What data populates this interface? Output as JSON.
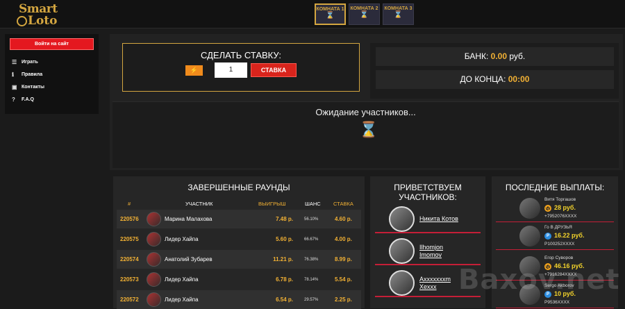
{
  "logo": {
    "line1": "Smart",
    "line2": "Loto"
  },
  "rooms": [
    {
      "label": "КОМНАТА 1",
      "icon": "⌛",
      "active": true
    },
    {
      "label": "КОМНАТА 2",
      "icon": "⌛",
      "active": false
    },
    {
      "label": "КОМНАТА 3",
      "icon": "⌛",
      "active": false
    }
  ],
  "sidebar": {
    "login_label": "Войти на сайт",
    "items": [
      {
        "icon": "☰",
        "label": "Играть"
      },
      {
        "icon": "ℹ",
        "label": "Правила"
      },
      {
        "icon": "▣",
        "label": "Контакты"
      },
      {
        "icon": "?",
        "label": "F.A.Q"
      }
    ]
  },
  "bet": {
    "title": "СДЕЛАТЬ СТАВКУ:",
    "bolt_icon": "⚡",
    "value": "1",
    "button_label": "СТАВКА"
  },
  "bank": {
    "bank_label": "БАНК:",
    "bank_value": "0.00",
    "bank_unit": "руб.",
    "timer_label": "ДО КОНЦА:",
    "timer_value": "00:00"
  },
  "waiting": {
    "text": "Ожидание участников...",
    "icon": "⌛"
  },
  "rounds": {
    "title": "ЗАВЕРШЕННЫЕ РАУНДЫ",
    "headers": {
      "num": "#",
      "participant": "УЧАСТНИК",
      "win": "ВЫИГРЫШ",
      "chance": "ШАНС",
      "stake": "СТАВКА"
    },
    "rows": [
      {
        "num": "220576",
        "name": "Марина Малахова",
        "win": "7.48 р.",
        "chance": "56.10%",
        "stake": "4.60 р."
      },
      {
        "num": "220575",
        "name": "Лидер Хайпа",
        "win": "5.60 р.",
        "chance": "66.67%",
        "stake": "4.00 р."
      },
      {
        "num": "220574",
        "name": "Анатолий Зубарев",
        "win": "11.21 р.",
        "chance": "76.38%",
        "stake": "8.99 р."
      },
      {
        "num": "220573",
        "name": "Лидер Хайпа",
        "win": "6.78 р.",
        "chance": "78.14%",
        "stake": "5.54 р."
      },
      {
        "num": "220572",
        "name": "Лидер Хайпа",
        "win": "6.54 р.",
        "chance": "29.57%",
        "stake": "2.25 р."
      }
    ]
  },
  "welcome": {
    "title_line1": "ПРИВЕТСТВУЕМ",
    "title_line2": "УЧАСТНИКОВ:",
    "users": [
      {
        "name_line1": "Никита Котов",
        "name_line2": ""
      },
      {
        "name_line1": "Ilhomjon",
        "name_line2": "Imomov"
      },
      {
        "name_line1": "Axxxxxxxm",
        "name_line2": "Xexxx"
      }
    ]
  },
  "payouts": {
    "title": "ПОСЛЕДНИЕ ВЫПЛАТЫ:",
    "items": [
      {
        "name": "Витя Торгашов",
        "system_icon": "Q",
        "system": "qiwi",
        "amount": "28 руб.",
        "account": "+7952076XXXX"
      },
      {
        "name": "Го В ДРУЗЬЯ",
        "system_icon": "P",
        "system": "payeer",
        "amount": "16.22 руб.",
        "account": "P100252XXXX"
      },
      {
        "name": "Егор Суворов",
        "system_icon": "Q",
        "system": "qiwi",
        "amount": "46.16 руб.",
        "account": "+7916284XXXX"
      },
      {
        "name": "Sergo Akborov",
        "system_icon": "P",
        "system": "payeer",
        "amount": "10 руб.",
        "account": "P9536XXXX"
      }
    ]
  },
  "watermark": "Baxov.net"
}
